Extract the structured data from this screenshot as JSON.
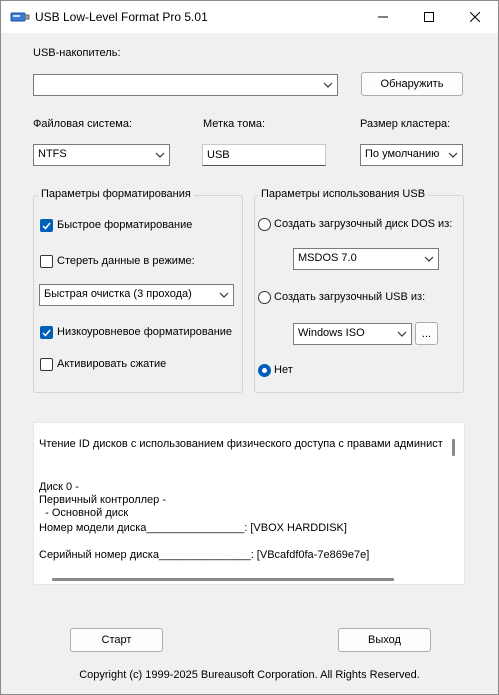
{
  "window": {
    "title": "USB Low-Level Format Pro 5.01"
  },
  "usb": {
    "label": "USB-накопитель:",
    "selected": "",
    "detect_button": "Обнаружить"
  },
  "filesystem": {
    "label": "Файловая система:",
    "value": "NTFS"
  },
  "volume": {
    "label": "Метка тома:",
    "value": "USB"
  },
  "cluster": {
    "label": "Размер кластера:",
    "value": "По умолчанию"
  },
  "format_params": {
    "title": "Параметры форматирования",
    "quick_format": "Быстрое форматирование",
    "quick_format_checked": true,
    "erase_mode": "Стереть данные в режиме:",
    "erase_mode_checked": false,
    "erase_option": "Быстрая очистка (3 прохода)",
    "low_level": "Низкоуровневое форматирование",
    "low_level_checked": true,
    "compression": "Активировать сжатие",
    "compression_checked": false
  },
  "usb_params": {
    "title": "Параметры использования USB",
    "dos_boot": "Создать загрузочный диск DOS из:",
    "dos_option": "MSDOS 7.0",
    "usb_boot": "Создать загрузочный USB из:",
    "usb_option": "Windows ISO",
    "browse_button": "...",
    "none": "Нет",
    "selected_option": "Нет"
  },
  "log": {
    "lines": [
      "Чтение ID дисков с использованием физического доступа с правами админист",
      "",
      "",
      "Диск 0 -",
      "Первичный контроллер -",
      "  - Основной диск",
      "Номер модели диска________________: [VBOX HARDDISK]",
      "",
      "Серийный номер диска_______________: [VBcafdf0fa-7e869e7e]"
    ]
  },
  "buttons": {
    "start": "Старт",
    "exit": "Выход"
  },
  "footer": {
    "copyright": "Copyright (c) 1999-2025 Bureausoft Corporation. All Rights Reserved."
  },
  "colors": {
    "accent": "#005fb8",
    "background": "#f0f0f0"
  }
}
